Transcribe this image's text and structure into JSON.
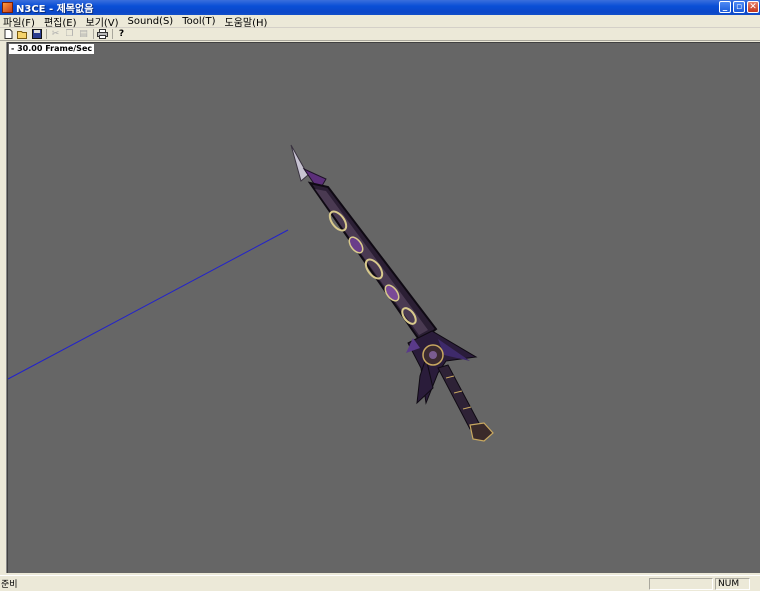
{
  "window": {
    "title": "N3CE - 제목없음"
  },
  "title_buttons": {
    "minimize": "_",
    "maximize": "▫",
    "close": "✕"
  },
  "menu": [
    "파일(F)",
    "편집(E)",
    "보기(V)",
    "Sound(S)",
    "Tool(T)",
    "도움말(H)"
  ],
  "toolbar": {
    "icons": [
      "new-file-icon",
      "open-folder-icon",
      "save-icon",
      "cut-icon",
      "copy-icon",
      "paste-icon",
      "print-icon",
      "help-icon"
    ]
  },
  "viewport": {
    "fps": "- 30.00 Frame/Sec",
    "background": "#666666",
    "axis_color": "#2222cc"
  },
  "status": {
    "text": "준비",
    "num": "NUM"
  }
}
